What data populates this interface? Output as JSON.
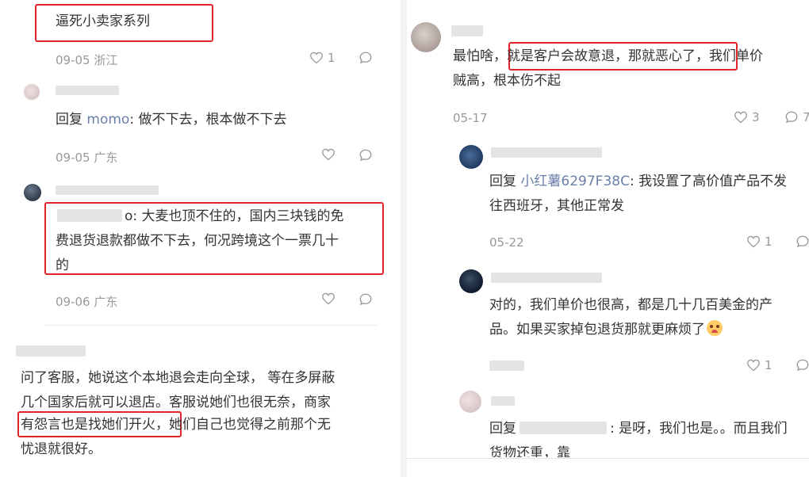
{
  "left": {
    "c1": {
      "text": "逼死小卖家系列",
      "date": "09-05 浙江",
      "likes": "1"
    },
    "c2": {
      "prefix": "回复 ",
      "mention": "momo",
      "text": ": 做不下去，根本做不下去",
      "date": "09-05 广东"
    },
    "c3": {
      "name_suffix": "o",
      "text_l1": ": 大麦也顶不住的，国内三块钱的免",
      "text_l2": "费退货退款都做不下去，何况跨境这个一票几十",
      "text_l3": "的",
      "date": "09-06 广东"
    },
    "c4": {
      "l1": "问了客服，她说这个本地退会走向全球， 等在多屏蔽",
      "l2": "几个国家后就可以退店。客服说她们也很无奈，商家",
      "l3_boxed": "有怨言也是找她们开火，",
      "l3_rest": "她们自己也觉得之前那个无",
      "l4": "忧退就很好。"
    }
  },
  "right": {
    "r1": {
      "pre": "最怕啥，",
      "boxed": "就是客户会故意退，那就恶心了，",
      "post": "我们单价",
      "l2": "贼高，根本伤不起",
      "date": "05-17",
      "likes": "3",
      "comments": "7"
    },
    "r2": {
      "prefix": "回复 ",
      "mention": "小红薯6297F38C",
      "text": ": 我设置了高价值产品不发",
      "l2": "往西班牙，其他正常发",
      "date": "05-22",
      "likes": "1"
    },
    "r3": {
      "l1": "对的，我们单价也很高，都是几十几百美金的产",
      "l2": "品。如果买家掉包退货那就更麻烦了",
      "likes": "1"
    },
    "r4": {
      "prefix": "回复",
      "text": ": 是呀，我们也是。。而且我们",
      "l2": "货物还重，靠"
    }
  },
  "colors": {
    "highlight": "#e0242a",
    "mention": "#6a7fa8",
    "meta": "#999999"
  }
}
